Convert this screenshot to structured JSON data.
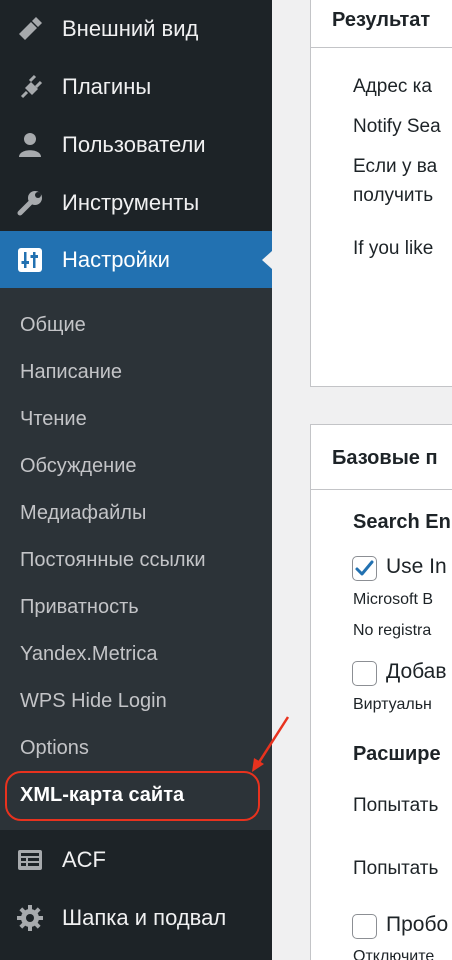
{
  "sidebar": {
    "menu": [
      {
        "label": "Внешний вид",
        "icon": "appearance-brush-icon"
      },
      {
        "label": "Плагины",
        "icon": "plugins-plug-icon"
      },
      {
        "label": "Пользователи",
        "icon": "users-person-icon"
      },
      {
        "label": "Инструменты",
        "icon": "tools-wrench-icon"
      },
      {
        "label": "Настройки",
        "icon": "settings-sliders-icon",
        "current": true
      }
    ],
    "submenu": [
      "Общие",
      "Написание",
      "Чтение",
      "Обсуждение",
      "Медиафайлы",
      "Постоянные ссылки",
      "Приватность",
      "Yandex.Metrica",
      "WPS Hide Login",
      "Options",
      "XML-карта сайта"
    ],
    "menu_after": [
      {
        "label": "ACF",
        "icon": "acf-grid-icon"
      },
      {
        "label": "Шапка и подвал",
        "icon": "gear-icon"
      }
    ]
  },
  "content": {
    "panel1": {
      "title": "Результат",
      "lines": [
        "Адрес ка",
        "Notify Sea",
        "Если у ва",
        "получить",
        "If you like"
      ]
    },
    "panel2": {
      "title": "Базовые п",
      "section1": "Search En",
      "option1": {
        "label": "Use In",
        "checked": true
      },
      "option1_desc": [
        "Microsoft B",
        "No registra"
      ],
      "option2": {
        "label": "Добав",
        "checked": false
      },
      "option2_desc": "Виртуальн",
      "section2": "Расшире",
      "text1": "Попытать",
      "text2": "Попытать",
      "option3": {
        "label": "Пробо",
        "checked": false
      },
      "option3_desc": "Отключите"
    }
  },
  "colors": {
    "sidebar_bg": "#1d2327",
    "submenu_bg": "#2c3338",
    "active_bg": "#2271b1",
    "annotation": "#e8321e",
    "checkbox_tick": "#2271b1"
  }
}
